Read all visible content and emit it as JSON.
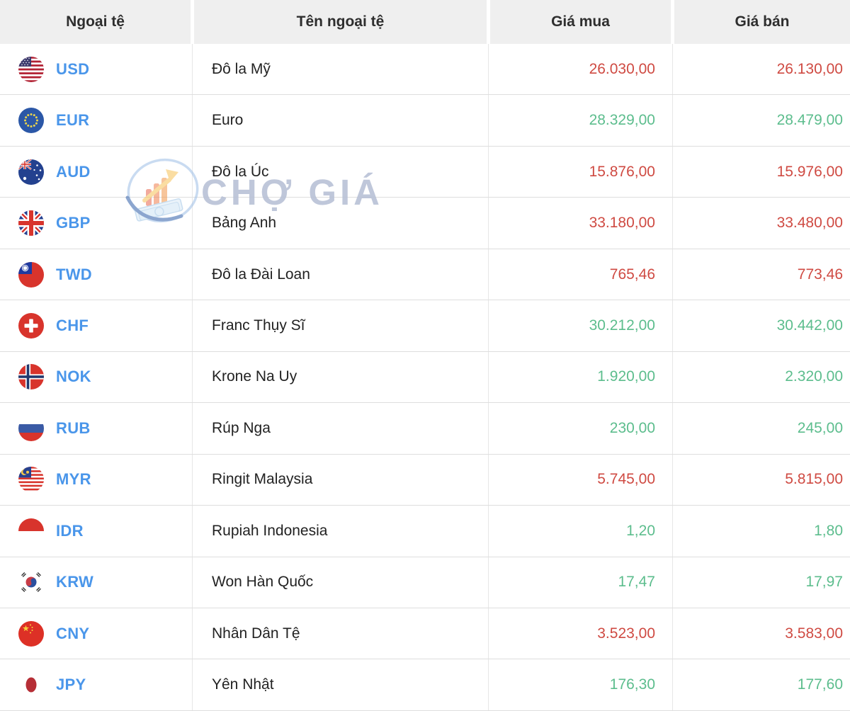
{
  "table": {
    "columns": [
      {
        "key": "currency",
        "label": "Ngoại tệ"
      },
      {
        "key": "name",
        "label": "Tên ngoại tệ"
      },
      {
        "key": "buy",
        "label": "Giá mua"
      },
      {
        "key": "sell",
        "label": "Giá bán"
      }
    ],
    "rows": [
      {
        "code": "USD",
        "icon": "usd-flag-icon",
        "name": "Đô la Mỹ",
        "buy": "26.030,00",
        "sell": "26.130,00",
        "trend": "down"
      },
      {
        "code": "EUR",
        "icon": "eur-flag-icon",
        "name": "Euro",
        "buy": "28.329,00",
        "sell": "28.479,00",
        "trend": "up"
      },
      {
        "code": "AUD",
        "icon": "aud-flag-icon",
        "name": "Đô la Úc",
        "buy": "15.876,00",
        "sell": "15.976,00",
        "trend": "down"
      },
      {
        "code": "GBP",
        "icon": "gbp-flag-icon",
        "name": "Bảng Anh",
        "buy": "33.180,00",
        "sell": "33.480,00",
        "trend": "down"
      },
      {
        "code": "TWD",
        "icon": "twd-flag-icon",
        "name": "Đô la Đài Loan",
        "buy": "765,46",
        "sell": "773,46",
        "trend": "down"
      },
      {
        "code": "CHF",
        "icon": "chf-flag-icon",
        "name": "Franc Thụy Sĩ",
        "buy": "30.212,00",
        "sell": "30.442,00",
        "trend": "up"
      },
      {
        "code": "NOK",
        "icon": "nok-flag-icon",
        "name": "Krone Na Uy",
        "buy": "1.920,00",
        "sell": "2.320,00",
        "trend": "up"
      },
      {
        "code": "RUB",
        "icon": "rub-flag-icon",
        "name": "Rúp Nga",
        "buy": "230,00",
        "sell": "245,00",
        "trend": "up"
      },
      {
        "code": "MYR",
        "icon": "myr-flag-icon",
        "name": "Ringit Malaysia",
        "buy": "5.745,00",
        "sell": "5.815,00",
        "trend": "down"
      },
      {
        "code": "IDR",
        "icon": "idr-flag-icon",
        "name": "Rupiah Indonesia",
        "buy": "1,20",
        "sell": "1,80",
        "trend": "up"
      },
      {
        "code": "KRW",
        "icon": "krw-flag-icon",
        "name": "Won Hàn Quốc",
        "buy": "17,47",
        "sell": "17,97",
        "trend": "up"
      },
      {
        "code": "CNY",
        "icon": "cny-flag-icon",
        "name": "Nhân Dân Tệ",
        "buy": "3.523,00",
        "sell": "3.583,00",
        "trend": "down"
      },
      {
        "code": "JPY",
        "icon": "jpy-flag-icon",
        "name": "Yên Nhật",
        "buy": "176,30",
        "sell": "177,60",
        "trend": "up"
      }
    ]
  },
  "watermark": {
    "text": "CHỢ GIÁ",
    "logo": "cho-gia-logo"
  },
  "colors": {
    "up_green": "#5cbd8d",
    "down_red": "#cf4a42",
    "code_blue": "#4a96ea",
    "header_bg": "#efefef",
    "row_border": "#dedede",
    "watermark_text": "#b7c0d6"
  }
}
